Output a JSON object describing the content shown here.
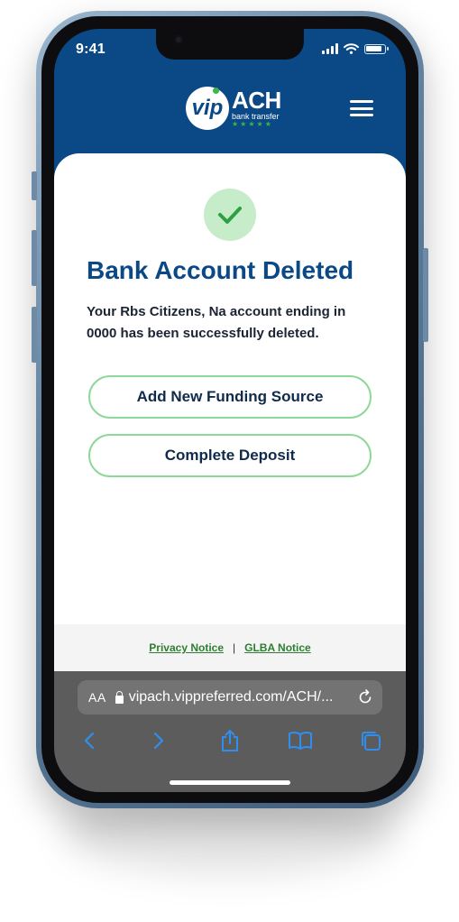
{
  "status_bar": {
    "time": "9:41"
  },
  "header": {
    "logo": {
      "circle_text": "vip",
      "main_text": "ACH",
      "sub_text": "bank transfer",
      "stars": "★★★★★"
    }
  },
  "confirmation": {
    "title": "Bank Account Deleted",
    "message": "Your Rbs Citizens, Na account ending in 0000 has been successfully deleted."
  },
  "actions": {
    "add_funding_label": "Add New Funding Source",
    "complete_deposit_label": "Complete Deposit"
  },
  "footer": {
    "privacy_label": "Privacy Notice",
    "separator": "|",
    "glba_label": "GLBA Notice"
  },
  "browser": {
    "text_size_label": "AA",
    "url": "vipach.vippreferred.com/ACH/..."
  },
  "colors": {
    "brand_blue": "#0a4986",
    "accent_green": "#3cb54a",
    "button_border": "#8ed899",
    "success_bg": "#c6ecca",
    "link_green": "#2e7d32",
    "safari_blue": "#2f8ff0"
  },
  "icons": [
    "signal-icon",
    "wifi-icon",
    "battery-icon",
    "menu-icon",
    "checkmark-icon",
    "lock-icon",
    "reload-icon",
    "back-icon",
    "forward-icon",
    "share-icon",
    "bookmarks-icon",
    "tabs-icon"
  ]
}
